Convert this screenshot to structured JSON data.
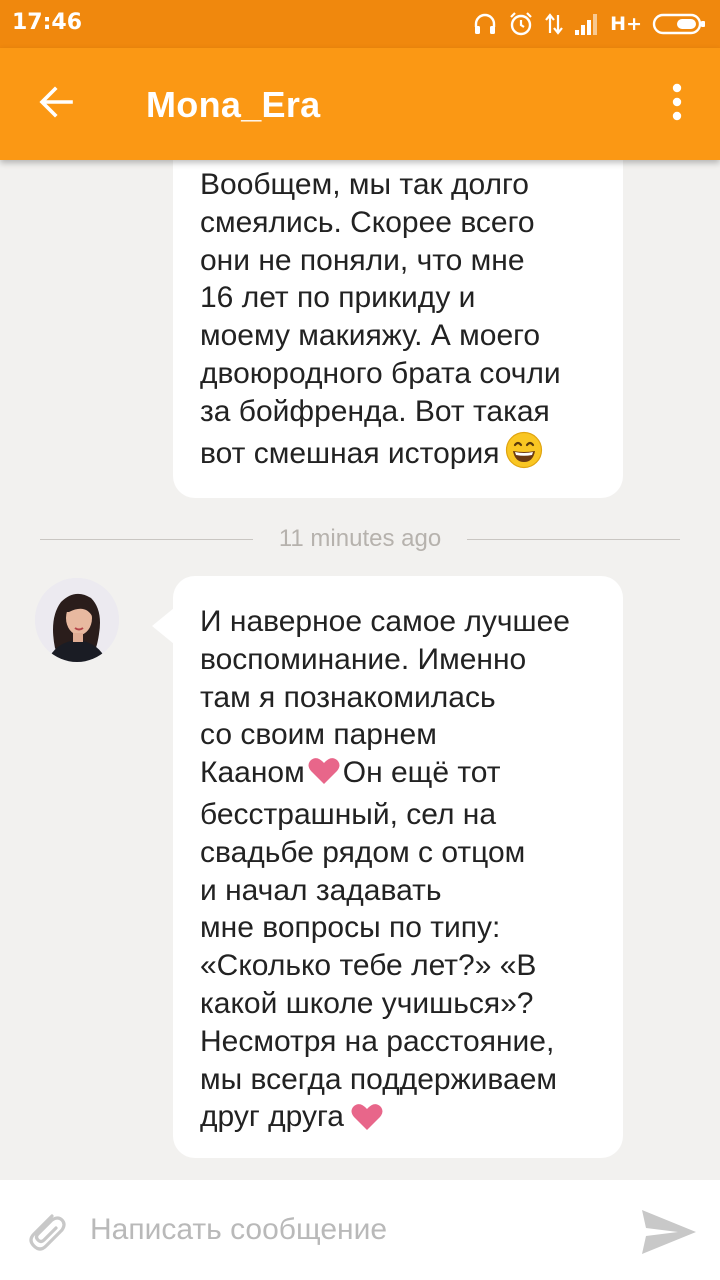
{
  "status_bar": {
    "time": "17:46",
    "network_type": "H+",
    "icons": [
      "headphones-icon",
      "alarm-icon",
      "data-arrows-icon",
      "signal-icon",
      "battery-icon"
    ]
  },
  "toolbar": {
    "title": "Mona_Era",
    "back_icon": "arrow-left-icon",
    "menu_icon": "more-vertical-icon"
  },
  "messages": [
    {
      "lines": [
        "Вообщем, мы так долго",
        "смеялись. Скорее всего",
        "они не поняли, что мне",
        "16 лет по прикиду и",
        "моему макияжу. А моего",
        "двоюродного брата сочли",
        "за бойфренда. Вот такая",
        "вот смешная история"
      ],
      "emoji": "grinning-face-icon"
    },
    {
      "lines": [
        "И наверное самое лучшее",
        "воспоминание. Именно",
        "там я познакомилась",
        "со своим парнем",
        "Кааном",
        "Он ещё тот",
        "бесстрашный, сел на",
        "свадьбе рядом с отцом",
        "и начал задавать",
        "мне вопросы по типу:",
        "«Сколько тебе лет?» «В",
        "какой школе учишься»?",
        "Несмотря на расстояние,",
        "мы всегда поддерживаем",
        "друг друга"
      ],
      "emoji": "heart-icon"
    }
  ],
  "separator": {
    "text": "11 minutes ago"
  },
  "composer": {
    "placeholder": "Написать сообщение",
    "value": ""
  },
  "colors": {
    "status_bar": "#f0880d",
    "toolbar": "#fb9814",
    "background": "#f2f1ef",
    "bubble": "#ffffff",
    "heart": "#e8668a"
  }
}
